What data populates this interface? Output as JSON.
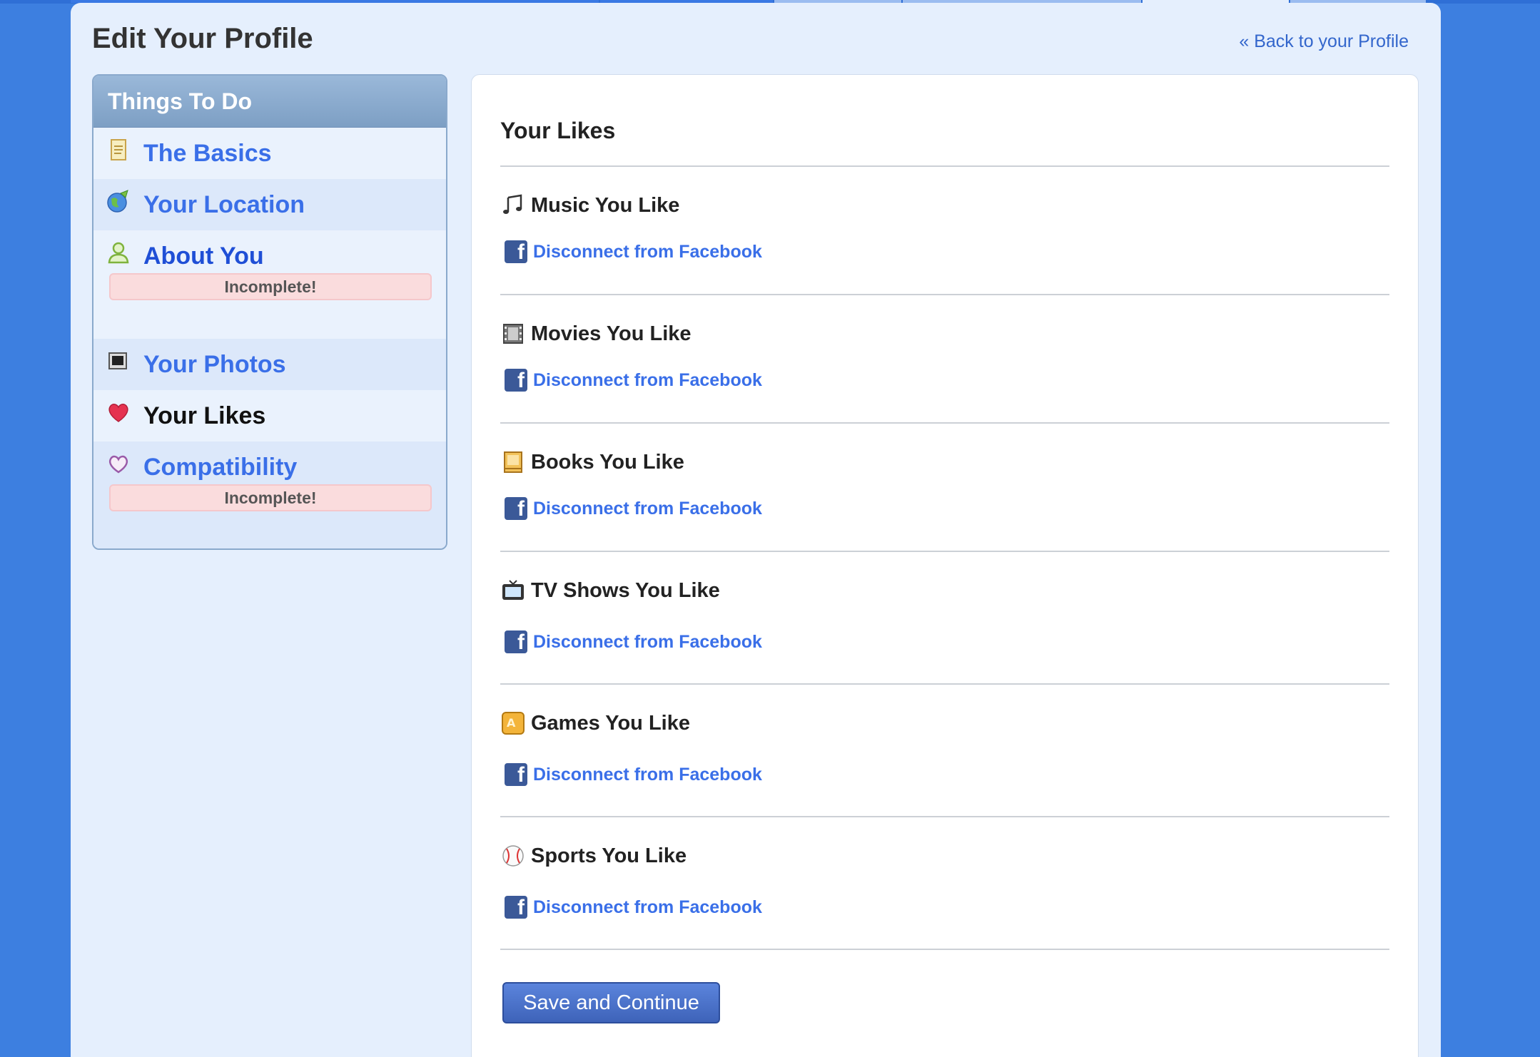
{
  "page": {
    "title": "Edit Your Profile",
    "back_link": "« Back to your Profile"
  },
  "sidebar": {
    "header": "Things To Do",
    "items": [
      {
        "label": "The Basics",
        "icon": "document-icon"
      },
      {
        "label": "Your Location",
        "icon": "globe-icon"
      },
      {
        "label": "About You",
        "icon": "person-icon",
        "status": "Incomplete!"
      },
      {
        "label": "Your Photos",
        "icon": "photo-frame-icon"
      },
      {
        "label": "Your Likes",
        "icon": "heart-icon",
        "current": true
      },
      {
        "label": "Compatibility",
        "icon": "heart-outline-icon",
        "status": "Incomplete!"
      }
    ]
  },
  "main": {
    "title": "Your Likes",
    "sections": [
      {
        "title": "Music You Like",
        "icon": "music-note-icon",
        "link": "Disconnect from Facebook"
      },
      {
        "title": "Movies You Like",
        "icon": "film-icon",
        "link": "Disconnect from Facebook"
      },
      {
        "title": "Books You Like",
        "icon": "book-icon",
        "link": "Disconnect from Facebook"
      },
      {
        "title": "TV Shows You Like",
        "icon": "tv-icon",
        "link": "Disconnect from Facebook"
      },
      {
        "title": "Games You Like",
        "icon": "game-icon",
        "link": "Disconnect from Facebook"
      },
      {
        "title": "Sports You Like",
        "icon": "baseball-icon",
        "link": "Disconnect from Facebook"
      }
    ],
    "save_label": "Save and Continue",
    "facebook_glyph": "f"
  },
  "colors": {
    "background": "#3d7fe0",
    "page": "#e5effd",
    "link": "#3a6fe8",
    "facebook": "#3b5998",
    "badge": "#fadcdd"
  }
}
